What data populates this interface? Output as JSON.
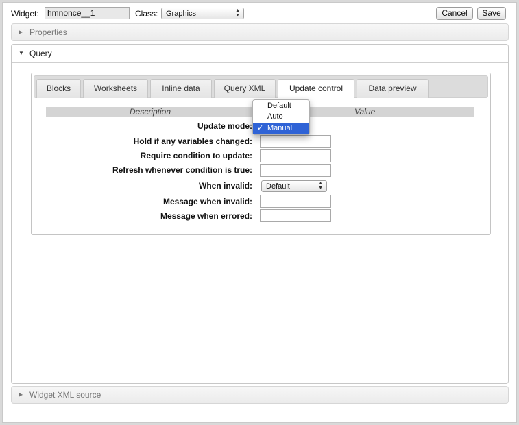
{
  "top": {
    "widget_label": "Widget:",
    "widget_value": "hmnonce__1",
    "class_label": "Class:",
    "class_value": "Graphics",
    "cancel_label": "Cancel",
    "save_label": "Save"
  },
  "sections": {
    "properties": "Properties",
    "query": "Query",
    "widget_xml": "Widget XML source"
  },
  "tabs": [
    {
      "label": "Blocks"
    },
    {
      "label": "Worksheets"
    },
    {
      "label": "Inline data"
    },
    {
      "label": "Query XML"
    },
    {
      "label": "Update control",
      "active": true
    },
    {
      "label": "Data preview"
    }
  ],
  "table": {
    "col_description": "Description",
    "col_value": "Value"
  },
  "rows": [
    {
      "label": "Update mode:"
    },
    {
      "label": "Hold if any variables changed:"
    },
    {
      "label": "Require condition to update:"
    },
    {
      "label": "Refresh whenever condition is true:"
    },
    {
      "label": "When invalid:",
      "select_value": "Default"
    },
    {
      "label": "Message when invalid:"
    },
    {
      "label": "Message when errored:"
    }
  ],
  "update_mode_dropdown": {
    "options": [
      "Default",
      "Auto",
      "Manual"
    ],
    "selected": "Manual",
    "check_glyph": "✓"
  },
  "colors": {
    "selection_blue": "#2f63d6",
    "tab_strip": "#dcdcdc",
    "table_header": "#d4d4d4"
  }
}
